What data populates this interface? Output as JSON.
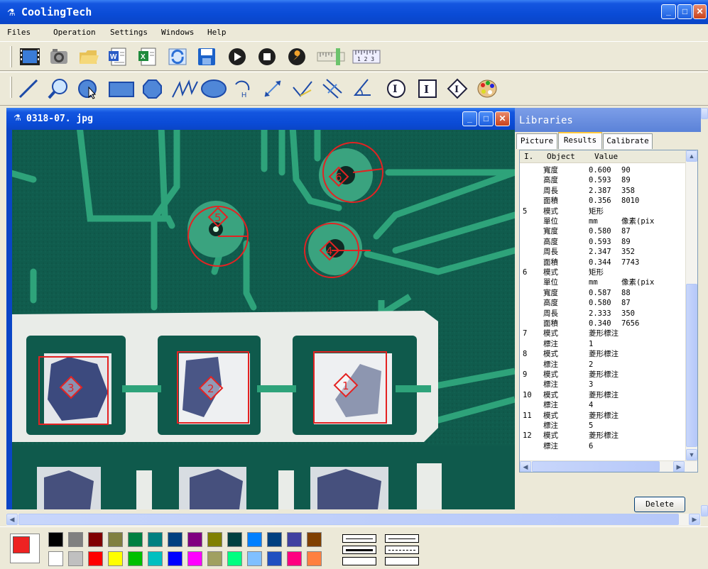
{
  "app": {
    "title": "CoolingTech"
  },
  "menu": [
    "Files",
    "Operation",
    "Settings",
    "Windows",
    "Help"
  ],
  "toolbar1": [
    "video-capture-icon",
    "camera-icon",
    "open-folder-icon",
    "word-export-icon",
    "excel-export-icon",
    "refresh-icon",
    "save-icon",
    "play-icon",
    "stop-icon",
    "settings-wrench-icon",
    "ruler-icon",
    "scale-bar-icon"
  ],
  "toolbar1_scale_label": "1 2 3",
  "toolbar2": [
    "line-tool-icon",
    "zoom-tool-icon",
    "circle-select-icon",
    "rectangle-tool-icon",
    "polygon-tool-icon",
    "polyline-tool-icon",
    "ellipse-tool-icon",
    "arc-tool-icon",
    "distance-tool-icon",
    "angle-tool-icon",
    "parallel-tool-icon",
    "angle-measure-icon",
    "circle-mark-icon",
    "text-mark-icon",
    "diamond-mark-icon",
    "color-palette-icon"
  ],
  "toolbar2_labels": {
    "arc": "H",
    "circle_mark": "Ⓘ",
    "text_mark": "I",
    "diamond_mark": "◈"
  },
  "image_window": {
    "title": "0318-07. jpg",
    "markers": [
      "1",
      "2",
      "3",
      "4",
      "5",
      "6"
    ]
  },
  "libraries": {
    "title": "Libraries",
    "tabs": [
      "Picture",
      "Results",
      "Calibrate"
    ],
    "active_tab": "Results",
    "columns": [
      "I.",
      "Object",
      "Value"
    ],
    "rows": [
      {
        "i": "",
        "obj": "寬度",
        "val": "0.600",
        "px": "90"
      },
      {
        "i": "",
        "obj": "高度",
        "val": "0.593",
        "px": "89"
      },
      {
        "i": "",
        "obj": "周長",
        "val": "2.387",
        "px": "358"
      },
      {
        "i": "",
        "obj": "面積",
        "val": "0.356",
        "px": "8010"
      },
      {
        "i": "5",
        "obj": "模式",
        "val": "矩形",
        "px": ""
      },
      {
        "i": "",
        "obj": "單位",
        "val": "mm",
        "px": "像素(pix"
      },
      {
        "i": "",
        "obj": "寬度",
        "val": "0.580",
        "px": "87"
      },
      {
        "i": "",
        "obj": "高度",
        "val": "0.593",
        "px": "89"
      },
      {
        "i": "",
        "obj": "周長",
        "val": "2.347",
        "px": "352"
      },
      {
        "i": "",
        "obj": "面積",
        "val": "0.344",
        "px": "7743"
      },
      {
        "i": "6",
        "obj": "模式",
        "val": "矩形",
        "px": ""
      },
      {
        "i": "",
        "obj": "單位",
        "val": "mm",
        "px": "像素(pix"
      },
      {
        "i": "",
        "obj": "寬度",
        "val": "0.587",
        "px": "88"
      },
      {
        "i": "",
        "obj": "高度",
        "val": "0.580",
        "px": "87"
      },
      {
        "i": "",
        "obj": "周長",
        "val": "2.333",
        "px": "350"
      },
      {
        "i": "",
        "obj": "面積",
        "val": "0.340",
        "px": "7656"
      },
      {
        "i": "7",
        "obj": "模式",
        "val": "菱形標注",
        "px": ""
      },
      {
        "i": "",
        "obj": "標注",
        "val": "1",
        "px": ""
      },
      {
        "i": "8",
        "obj": "模式",
        "val": "菱形標注",
        "px": ""
      },
      {
        "i": "",
        "obj": "標注",
        "val": "2",
        "px": ""
      },
      {
        "i": "9",
        "obj": "模式",
        "val": "菱形標注",
        "px": ""
      },
      {
        "i": "",
        "obj": "標注",
        "val": "3",
        "px": ""
      },
      {
        "i": "10",
        "obj": "模式",
        "val": "菱形標注",
        "px": ""
      },
      {
        "i": "",
        "obj": "標注",
        "val": "4",
        "px": ""
      },
      {
        "i": "11",
        "obj": "模式",
        "val": "菱形標注",
        "px": ""
      },
      {
        "i": "",
        "obj": "標注",
        "val": "5",
        "px": ""
      },
      {
        "i": "12",
        "obj": "模式",
        "val": "菱形標注",
        "px": ""
      },
      {
        "i": "",
        "obj": "標注",
        "val": "6",
        "px": ""
      }
    ],
    "delete_label": "Delete"
  },
  "palette": {
    "current": "#ee2222",
    "row1": [
      "#000000",
      "#808080",
      "#800000",
      "#808040",
      "#008040",
      "#008080",
      "#004080",
      "#800080",
      "#808000",
      "#004040",
      "#0080ff",
      "#004080",
      "#4040a0",
      "#804000"
    ],
    "row2": [
      "#ffffff",
      "#c0c0c0",
      "#ff0000",
      "#ffff00",
      "#00c000",
      "#00c0c0",
      "#0000ff",
      "#ff00ff",
      "#a0a060",
      "#00ff80",
      "#80c0ff",
      "#2050c0",
      "#ff0080",
      "#ff8040"
    ]
  }
}
